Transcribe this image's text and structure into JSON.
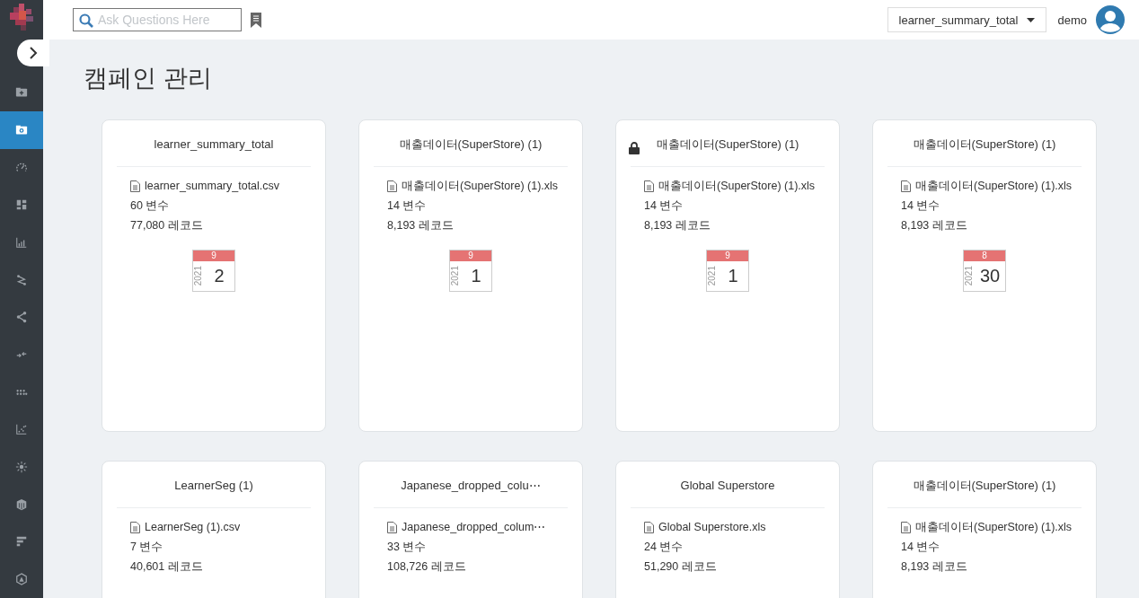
{
  "sidebar": {
    "items": [
      {
        "selected": false
      },
      {
        "selected": true
      },
      {
        "selected": false
      },
      {
        "selected": false
      },
      {
        "selected": false
      },
      {
        "selected": false
      },
      {
        "selected": false
      },
      {
        "selected": false
      },
      {
        "selected": false
      },
      {
        "selected": false
      },
      {
        "selected": false
      },
      {
        "selected": false
      },
      {
        "selected": false
      },
      {
        "selected": false
      }
    ]
  },
  "topbar": {
    "search": {
      "placeholder": "Ask Questions Here"
    },
    "dataset_select": "learner_summary_total",
    "user": "demo"
  },
  "page_title": "캠페인 관리",
  "cards": [
    {
      "title": "learner_summary_total",
      "locked": false,
      "file": "learner_summary_total.csv",
      "variables": "60 변수",
      "records": "77,080 레코드",
      "calendar": {
        "month": "9",
        "year": "2021",
        "day": "2"
      }
    },
    {
      "title": "매출데이터(SuperStore) (1)",
      "locked": false,
      "file": "매출데이터(SuperStore) (1).xls",
      "variables": "14 변수",
      "records": "8,193 레코드",
      "calendar": {
        "month": "9",
        "year": "2021",
        "day": "1"
      }
    },
    {
      "title": "매출데이터(SuperStore) (1)",
      "locked": true,
      "file": "매출데이터(SuperStore) (1).xls",
      "variables": "14 변수",
      "records": "8,193 레코드",
      "calendar": {
        "month": "9",
        "year": "2021",
        "day": "1"
      }
    },
    {
      "title": "매출데이터(SuperStore) (1)",
      "locked": false,
      "file": "매출데이터(SuperStore) (1).xls",
      "variables": "14 변수",
      "records": "8,193 레코드",
      "calendar": {
        "month": "8",
        "year": "2021",
        "day": "30"
      }
    },
    {
      "title": "LearnerSeg (1)",
      "locked": false,
      "file": "LearnerSeg (1).csv",
      "variables": "7 변수",
      "records": "40,601 레코드"
    },
    {
      "title": "Japanese_dropped_colu⋯",
      "locked": false,
      "file": "Japanese_dropped_colum⋯",
      "variables": "33 변수",
      "records": "108,726 레코드"
    },
    {
      "title": "Global Superstore",
      "locked": false,
      "file": "Global Superstore.xls",
      "variables": "24 변수",
      "records": "51,290 레코드"
    },
    {
      "title": "매출데이터(SuperStore) (1)",
      "locked": false,
      "file": "매출데이터(SuperStore) (1).xls",
      "variables": "14 변수",
      "records": "8,193 레코드"
    }
  ]
}
